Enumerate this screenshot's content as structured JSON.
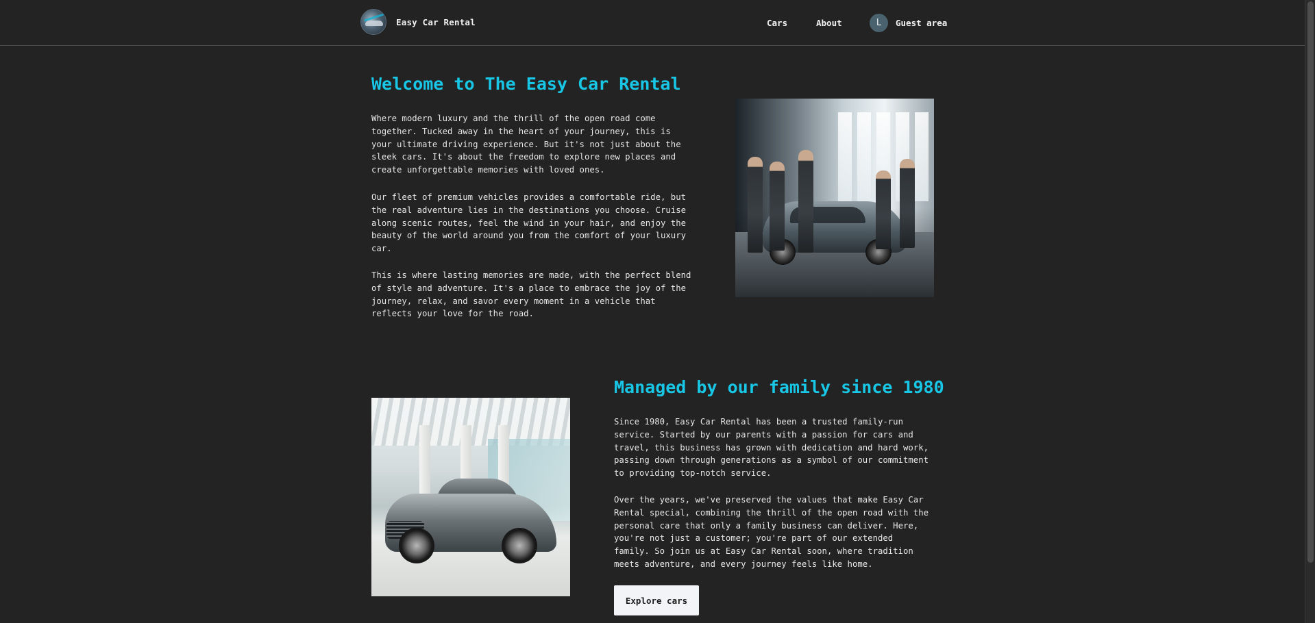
{
  "header": {
    "brand": "Easy Car Rental",
    "nav": {
      "cars": "Cars",
      "about": "About"
    },
    "user": {
      "avatar_initial": "L",
      "label": "Guest area"
    }
  },
  "welcome": {
    "title": "Welcome to The Easy Car Rental",
    "paragraphs": [
      "Where modern luxury and the thrill of the open road come together. Tucked away in the heart of your journey, this is your ultimate driving experience. But it's not just about the sleek cars. It's about the freedom to explore new places and create unforgettable memories with loved ones.",
      "Our fleet of premium vehicles provides a comfortable ride, but the real adventure lies in the destinations you choose. Cruise along scenic routes, feel the wind in your hair, and enjoy the beauty of the world around you from the comfort of your luxury car.",
      "This is where lasting memories are made, with the perfect blend of style and adventure. It's a place to embrace the joy of the journey, relax, and savor every moment in a vehicle that reflects your love for the road."
    ]
  },
  "family": {
    "title": "Managed by our family since 1980",
    "paragraphs": [
      "Since 1980, Easy Car Rental has been a trusted family-run service. Started by our parents with a passion for cars and travel, this business has grown with dedication and hard work, passing down through generations as a symbol of our commitment to providing top-notch service.",
      "Over the years, we've preserved the values that make Easy Car Rental special, combining the thrill of the open road with the personal care that only a family business can deliver. Here, you're not just a customer; you're part of our extended family. So join us at Easy Car Rental soon, where tradition meets adventure, and every journey feels like home."
    ],
    "cta": "Explore cars"
  },
  "colors": {
    "background": "#232323",
    "accent": "#18c6e6",
    "button_bg": "#f2f4f7",
    "avatar_bg": "#49626e"
  }
}
